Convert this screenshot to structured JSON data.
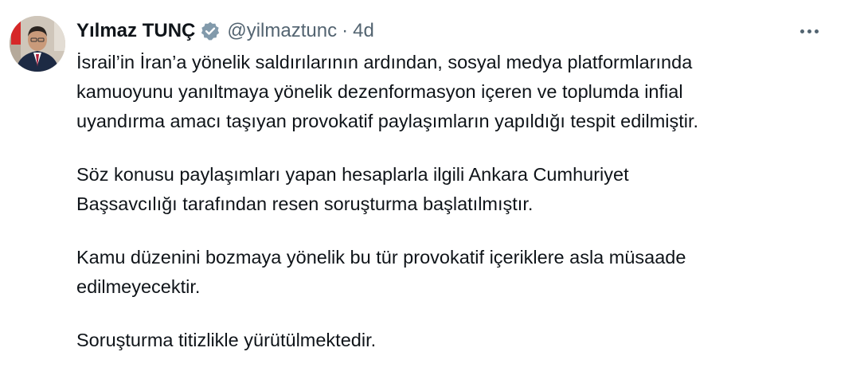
{
  "tweet": {
    "author": {
      "display_name": "Yılmaz TUNÇ",
      "handle": "@yilmaztunc",
      "verified": true,
      "verified_badge_color": "#829aab"
    },
    "separator": "·",
    "time": "4d",
    "more_icon": "more-horizontal-icon",
    "paragraphs": [
      [
        "İsrail’in İran’a yönelik saldırılarının ardından, sosyal medya platformlarında",
        "kamuoyunu yanıltmaya yönelik dezenformasyon içeren ve toplumda infial",
        "uyandırma amacı taşıyan provokatif paylaşımların yapıldığı tespit edilmiştir."
      ],
      [
        "Söz konusu paylaşımları yapan hesaplarla ilgili Ankara Cumhuriyet",
        "Başsavcılığı tarafından resen soruşturma başlatılmıştır."
      ],
      [
        "Kamu düzenini bozmaya yönelik bu tür provokatif içeriklere asla müsaade",
        "edilmeyecektir."
      ],
      [
        "Soruşturma titizlikle yürütülmektedir."
      ]
    ]
  }
}
